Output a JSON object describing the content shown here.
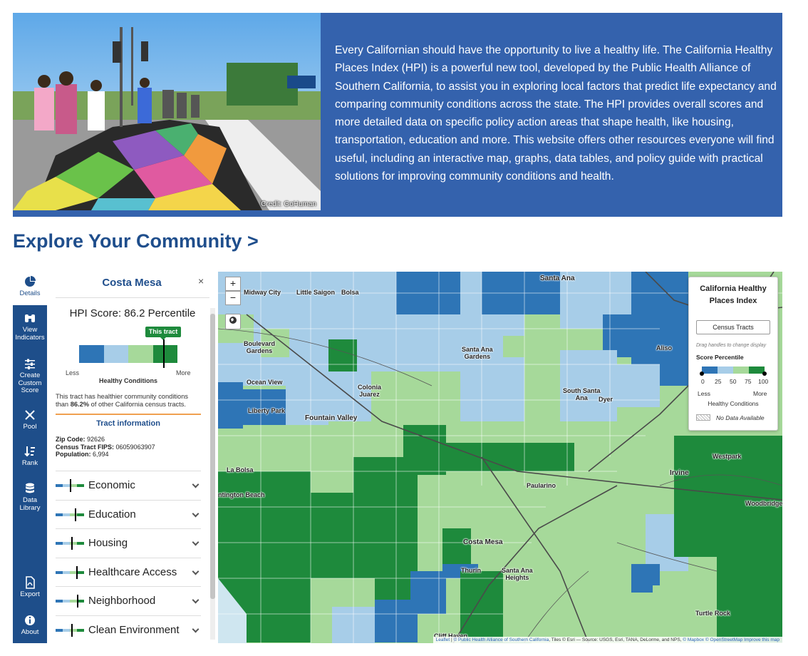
{
  "hero": {
    "credit": "Credit: GoHuman",
    "text": "Every Californian should have the opportunity to live a healthy life. The California Healthy Places Index (HPI) is a powerful new tool, developed by the Public Health Alliance of Southern California, to assist you in exploring local factors that predict life expectancy and comparing community conditions across the state. The HPI provides overall scores and more detailed data on specific policy action areas that shape health, like housing, transportation, education and more. This website offers other resources everyone will find useful, including an interactive map, graphs, data tables, and policy guide with practical solutions for improving community conditions and health."
  },
  "explore_heading": "Explore Your Community >",
  "rail": {
    "details": "Details",
    "view_indicators": [
      "View",
      "Indicators"
    ],
    "create_custom": [
      "Create",
      "Custom",
      "Score"
    ],
    "pool": "Pool",
    "rank": "Rank",
    "data_library": [
      "Data",
      "Library"
    ],
    "export": "Export",
    "about": "About"
  },
  "panel": {
    "title": "Costa Mesa",
    "close": "×",
    "hpi_score": "HPI Score: 86.2 Percentile",
    "tract_tag": "This tract",
    "percentile": 86.2,
    "less": "Less",
    "more": "More",
    "healthy_conditions": "Healthy Conditions",
    "summary_pre": "This tract has healthier community conditions than ",
    "summary_bold": "86.2%",
    "summary_post": " of other California census tracts.",
    "tract_info_heading": "Tract information",
    "zip_label": "Zip Code:",
    "zip_value": " 92626",
    "fips_label": "Census Tract FIPS:",
    "fips_value": " 06059063907",
    "pop_label": "Population:",
    "pop_value": " 6,994",
    "accordions": [
      {
        "label": "Economic",
        "level": 0.5
      },
      {
        "label": "Education",
        "level": 0.68
      },
      {
        "label": "Housing",
        "level": 0.55
      },
      {
        "label": "Healthcare Access",
        "level": 0.72
      },
      {
        "label": "Neighborhood",
        "level": 0.74
      },
      {
        "label": "Clean Environment",
        "level": 0.55
      }
    ]
  },
  "colors": {
    "q1": "#2e75b6",
    "q2": "#a7cde8",
    "q3": "#a6d99a",
    "q4": "#1e8a3c",
    "hero_bg": "#3462ad",
    "heading": "#1f4e8c"
  },
  "map": {
    "zoom_in": "+",
    "zoom_out": "−",
    "labels": [
      {
        "text": "Santa Ana",
        "big": true
      },
      {
        "text": "Midway City"
      },
      {
        "text": "Little Saigon"
      },
      {
        "text": "Bolsa"
      },
      {
        "text": "Boulevard Gardens"
      },
      {
        "text": "Santa Ana Gardens"
      },
      {
        "text": "Aliso"
      },
      {
        "text": "Ocean View"
      },
      {
        "text": "Colonia Juarez"
      },
      {
        "text": "South Santa Ana"
      },
      {
        "text": "Dyer"
      },
      {
        "text": "Liberty Park"
      },
      {
        "text": "Fountain Valley",
        "big": true
      },
      {
        "text": "Westpark"
      },
      {
        "text": "La Bolsa"
      },
      {
        "text": "Irvine",
        "big": true
      },
      {
        "text": "ntington Beach"
      },
      {
        "text": "Paularino"
      },
      {
        "text": "Woodbridge"
      },
      {
        "text": "Costa Mesa",
        "big": true
      },
      {
        "text": "Thurin"
      },
      {
        "text": "Santa Ana Heights"
      },
      {
        "text": "Turtle Rock"
      },
      {
        "text": "Cliff Haven"
      }
    ],
    "legend": {
      "title": "California Healthy Places Index",
      "button": "Census Tracts",
      "hint": "Drag handles to change display",
      "score_percentile": "Score Percentile",
      "ticks": [
        "0",
        "25",
        "50",
        "75",
        "100"
      ],
      "less": "Less",
      "more": "More",
      "healthy_conditions": "Healthy Conditions",
      "no_data": "No Data Available"
    },
    "attribution": {
      "leaflet": "Leaflet",
      "alliance": "© Public Health Alliance of Southern California",
      "tiles": ", Tiles © Esri — Source: USGS, Esri, TANA, DeLorme, and NPS, ",
      "mapbox": "© Mapbox",
      "osm": "© OpenStreetMap",
      "improve": "Improve this map"
    }
  }
}
